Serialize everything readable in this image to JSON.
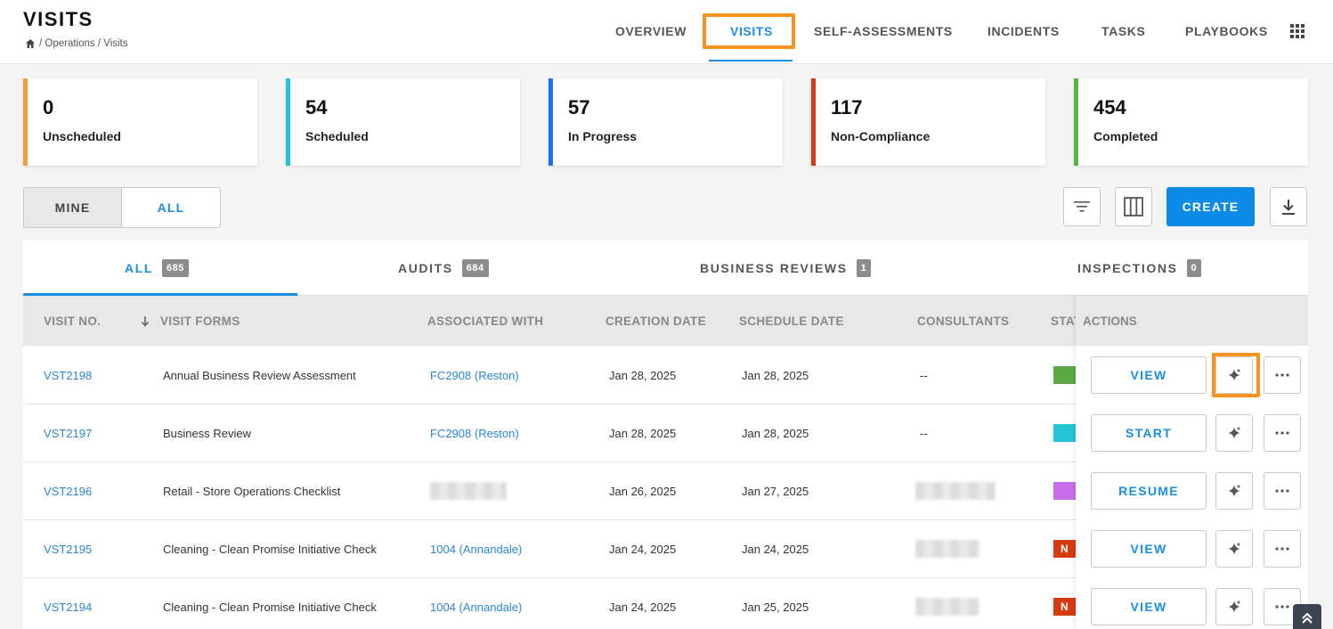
{
  "header": {
    "title": "VISITS",
    "breadcrumb": "/ Operations / Visits"
  },
  "nav": {
    "items": [
      "OVERVIEW",
      "VISITS",
      "SELF-ASSESSMENTS",
      "INCIDENTS",
      "TASKS",
      "PLAYBOOKS"
    ],
    "active": "VISITS"
  },
  "stats": [
    {
      "value": "0",
      "label": "Unscheduled",
      "color": "#f79a3e"
    },
    {
      "value": "54",
      "label": "Scheduled",
      "color": "#23c4d4"
    },
    {
      "value": "57",
      "label": "In Progress",
      "color": "#1e6ef0"
    },
    {
      "value": "117",
      "label": "Non-Compliance",
      "color": "#d83a10"
    },
    {
      "value": "454",
      "label": "Completed",
      "color": "#5db345"
    }
  ],
  "toggle": {
    "mine": "MINE",
    "all": "ALL"
  },
  "toolbar": {
    "create_label": "CREATE"
  },
  "subtabs": [
    {
      "label": "ALL",
      "count": "685"
    },
    {
      "label": "AUDITS",
      "count": "684"
    },
    {
      "label": "BUSINESS REVIEWS",
      "count": "1"
    },
    {
      "label": "INSPECTIONS",
      "count": "0"
    }
  ],
  "table": {
    "headers": {
      "visit_no": "VISIT NO.",
      "visit_forms": "VISIT FORMS",
      "associated_with": "ASSOCIATED WITH",
      "creation_date": "CREATION DATE",
      "schedule_date": "SCHEDULE DATE",
      "consultants": "CONSULTANTS",
      "status": "STAT",
      "actions": "ACTIONS"
    },
    "rows": [
      {
        "visit_no": "VST2198",
        "form": "Annual Business Review Assessment",
        "assoc": "FC2908 (Reston)",
        "created": "Jan 28, 2025",
        "scheduled": "Jan 28, 2025",
        "consultants": "--",
        "status_text": "",
        "status_color": "#5ca845",
        "action": "VIEW"
      },
      {
        "visit_no": "VST2197",
        "form": "Business Review",
        "assoc": "FC2908 (Reston)",
        "created": "Jan 28, 2025",
        "scheduled": "Jan 28, 2025",
        "consultants": "--",
        "status_text": "",
        "status_color": "#23c4d4",
        "action": "START"
      },
      {
        "visit_no": "VST2196",
        "form": "Retail - Store Operations Checklist",
        "assoc": "",
        "created": "Jan 26, 2025",
        "scheduled": "Jan 27, 2025",
        "consultants": "",
        "status_text": "",
        "status_color": "#c96ee8",
        "action": "RESUME"
      },
      {
        "visit_no": "VST2195",
        "form": "Cleaning - Clean Promise Initiative Check",
        "assoc": "1004 (Annandale)",
        "created": "Jan 24, 2025",
        "scheduled": "Jan 24, 2025",
        "consultants": "",
        "status_text": "N",
        "status_color": "#d83a10",
        "action": "VIEW"
      },
      {
        "visit_no": "VST2194",
        "form": "Cleaning - Clean Promise Initiative Check",
        "assoc": "1004 (Annandale)",
        "created": "Jan 24, 2025",
        "scheduled": "Jan 25, 2025",
        "consultants": "",
        "status_text": "N",
        "status_color": "#d83a10",
        "action": "VIEW"
      }
    ]
  }
}
